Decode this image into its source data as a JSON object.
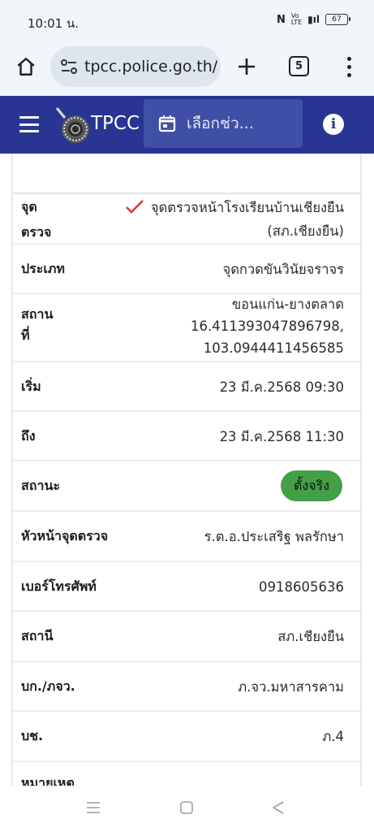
{
  "status_bar": {
    "time": "10:01 น.",
    "battery": "67"
  },
  "browser": {
    "url": "tpcc.police.go.th/",
    "tab_count": "5"
  },
  "app_bar": {
    "brand": "TPCC",
    "date_placeholder": "เลือกช่ว..."
  },
  "details": [
    {
      "label": "จุด\nตรวจ",
      "value": "จุดตรวจหน้าโรงเรียนบ้านเชียงยืน\n(สภ.เชียงยืน)"
    },
    {
      "label": "ประเภท",
      "value": "จุดกวดขันวินัยจราจร"
    },
    {
      "label": "สถาน\nที่",
      "value": "ขอนแก่น-ยางตลาด\n16.411393047896798,\n103.0944411456585"
    },
    {
      "label": "เริ่ม",
      "value": "23 มี.ค.2568 09:30"
    },
    {
      "label": "ถึง",
      "value": "23 มี.ค.2568 11:30"
    },
    {
      "label": "สถานะ",
      "value": "ตั้งจริง"
    },
    {
      "label": "หัวหน้าจุดตรวจ",
      "value": "ร.ต.อ.ประเสริฐ พลรักษา"
    },
    {
      "label": "เบอร์โทรศัพท์",
      "value": "0918605636"
    },
    {
      "label": "สถานี",
      "value": "สภ.เชียงยืน"
    },
    {
      "label": "บก./ภจว.",
      "value": "ภ.จว.มหาสารคาม"
    },
    {
      "label": "บช.",
      "value": "ภ.4"
    },
    {
      "label": "หมายเหตุ",
      "value": ""
    }
  ],
  "colors": {
    "app_bar": "#283593",
    "status_badge": "#43a047",
    "check_mark": "#e53935"
  }
}
